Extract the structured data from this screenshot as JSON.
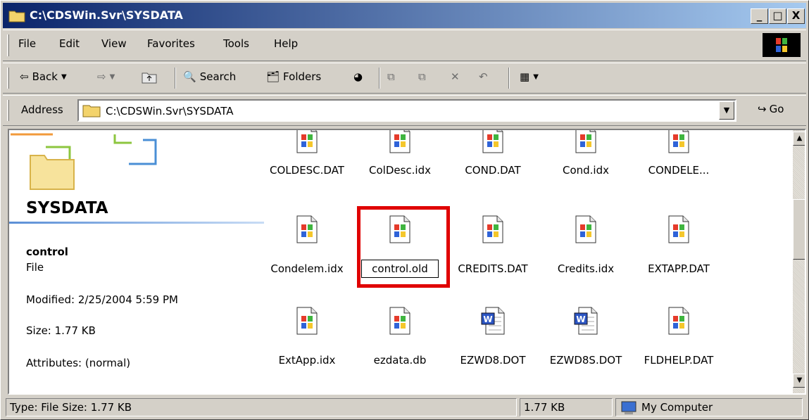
{
  "window": {
    "title": "C:\\CDSWin.Svr\\SYSDATA",
    "min": "_",
    "max": "□",
    "close": "X"
  },
  "menu": [
    "File",
    "Edit",
    "View",
    "Favorites",
    "Tools",
    "Help"
  ],
  "toolbar": {
    "back": "Back",
    "search": "Search",
    "folders": "Folders"
  },
  "address": {
    "label": "Address",
    "value": "C:\\CDSWin.Svr\\SYSDATA",
    "go": "Go"
  },
  "leftpane": {
    "folder_title": "SYSDATA",
    "selected_name": "control",
    "selected_type": "File",
    "modified": "Modified: 2/25/2004 5:59 PM",
    "size": "Size: 1.77 KB",
    "attributes": "Attributes: (normal)"
  },
  "files": [
    {
      "name": "COLDESC.DAT",
      "icon": "windows-file-icon"
    },
    {
      "name": "ColDesc.idx",
      "icon": "windows-file-icon"
    },
    {
      "name": "COND.DAT",
      "icon": "windows-file-icon"
    },
    {
      "name": "Cond.idx",
      "icon": "windows-file-icon"
    },
    {
      "name": "CONDELE...",
      "icon": "windows-file-icon"
    },
    {
      "name": "Condelem.idx",
      "icon": "windows-file-icon"
    },
    {
      "name": "control.old",
      "icon": "windows-file-icon"
    },
    {
      "name": "CREDITS.DAT",
      "icon": "windows-file-icon"
    },
    {
      "name": "Credits.idx",
      "icon": "windows-file-icon"
    },
    {
      "name": "EXTAPP.DAT",
      "icon": "windows-file-icon"
    },
    {
      "name": "ExtApp.idx",
      "icon": "windows-file-icon"
    },
    {
      "name": "ezdata.db",
      "icon": "windows-file-icon"
    },
    {
      "name": "EZWD8.DOT",
      "icon": "word-document-icon"
    },
    {
      "name": "EZWD8S.DOT",
      "icon": "word-document-icon"
    },
    {
      "name": "FLDHELP.DAT",
      "icon": "windows-file-icon"
    }
  ],
  "status": {
    "main": "Type: File Size: 1.77 KB",
    "size": "1.77 KB",
    "zone": "My Computer"
  },
  "colors": {
    "highlight": "#e00000",
    "titlebar_start": "#0a246a",
    "titlebar_end": "#a6caf0"
  }
}
